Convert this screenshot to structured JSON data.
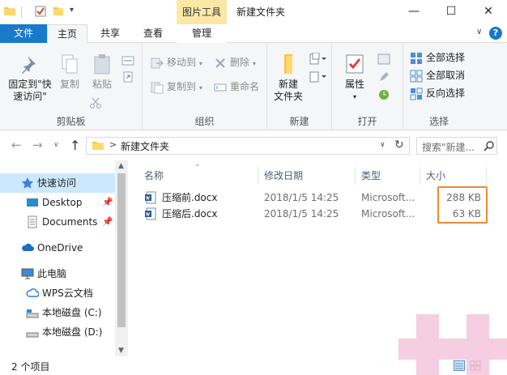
{
  "window": {
    "contextual_tab_title": "图片工具",
    "title": "新建文件夹",
    "minimize": "—",
    "maximize": "☐",
    "close": "✕"
  },
  "quick_access_dropdown": "▾",
  "tabs": {
    "file": "文件",
    "home": "主页",
    "share": "共享",
    "view": "查看",
    "manage": "管理"
  },
  "ribbon_collapse": "∨",
  "help": "?",
  "ribbon": {
    "clipboard": {
      "label": "剪贴板",
      "pin_line1": "固定到\"快",
      "pin_line2": "速访问\"",
      "copy": "复制",
      "paste": "粘贴"
    },
    "organize": {
      "label": "组织",
      "move_to": "移动到",
      "copy_to": "复制到",
      "delete": "删除",
      "rename": "重命名"
    },
    "new": {
      "label": "新建",
      "new_folder_line1": "新建",
      "new_folder_line2": "文件夹"
    },
    "open": {
      "label": "打开",
      "properties": "属性"
    },
    "select": {
      "label": "选择",
      "select_all": "全部选择",
      "select_none": "全部取消",
      "invert": "反向选择"
    }
  },
  "address": {
    "back": "←",
    "forward": "→",
    "recent": "∨",
    "up": "↑",
    "separator": ">",
    "path": "新建文件夹",
    "dropdown": "∨",
    "refresh": "↻",
    "search_placeholder": "搜索\"新建..."
  },
  "nav_pane": {
    "pin_glyph": "📌",
    "items": [
      {
        "label": "快速访问",
        "icon": "star-icon"
      },
      {
        "label": "Desktop",
        "icon": "desktop-icon"
      },
      {
        "label": "Documents",
        "icon": "documents-icon"
      },
      {
        "label": "OneDrive",
        "icon": "cloud-icon"
      },
      {
        "label": "此电脑",
        "icon": "computer-icon"
      },
      {
        "label": "WPS云文档",
        "icon": "wps-cloud-icon"
      },
      {
        "label": "本地磁盘 (C:)",
        "icon": "drive-icon"
      },
      {
        "label": "本地磁盘 (D:)",
        "icon": "drive-icon"
      }
    ]
  },
  "file_list": {
    "sort_caret": "⌄",
    "columns": [
      "名称",
      "修改日期",
      "类型",
      "大小"
    ],
    "rows": [
      {
        "name": "压缩前.docx",
        "date": "2018/1/5 14:25",
        "type": "Microsoft...",
        "size": "288 KB"
      },
      {
        "name": "压缩后.docx",
        "date": "2018/1/5 14:25",
        "type": "Microsoft...",
        "size": "63 KB"
      }
    ]
  },
  "status": {
    "item_count": "2 个项目"
  },
  "colors": {
    "accent": "#1979ca",
    "contextual_tab": "#fbe8a6",
    "highlight": "#ee8a30",
    "selection": "#cce8ff"
  }
}
